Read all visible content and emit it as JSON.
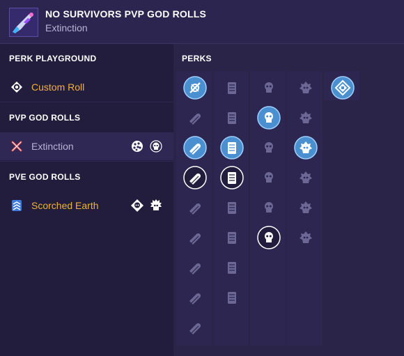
{
  "header": {
    "title": "NO SURVIVORS PVP GOD ROLLS",
    "subtitle": "Extinction",
    "weapon_icon": "weapon-thumbnail"
  },
  "sidebar": {
    "sections": [
      {
        "title": "PERK PLAYGROUND",
        "items": [
          {
            "label": "Custom Roll",
            "icon": "target-icon",
            "color": "#f2b233",
            "selected": false,
            "mini_icons": []
          }
        ]
      },
      {
        "title": "PVP GOD ROLLS",
        "items": [
          {
            "label": "Extinction",
            "icon": "crossed-swords-icon",
            "color": "#b9b4d6",
            "selected": true,
            "mini_icons": [
              "dots-icon",
              "skull-icon"
            ]
          }
        ]
      },
      {
        "title": "PVE GOD ROLLS",
        "items": [
          {
            "label": "Scorched Earth",
            "icon": "chevrons-icon",
            "color": "#f2b233",
            "selected": false,
            "mini_icons": [
              "diamond-skull-icon",
              "flame-skull-icon"
            ]
          }
        ]
      }
    ]
  },
  "perks": {
    "title": "PERKS",
    "columns": [
      [
        "scope-selected",
        "barrel-dim",
        "barrel-selected",
        "barrel-white",
        "barrel-dim",
        "barrel-dim",
        "barrel-dim",
        "barrel-dim",
        "barrel-dim"
      ],
      [
        "magazine-dim",
        "magazine-dim",
        "magazine-selected",
        "magazine-white",
        "magazine-dim",
        "magazine-dim",
        "magazine-dim",
        "magazine-dim"
      ],
      [
        "trait-dim",
        "trait-selected",
        "trait-dim",
        "trait-dim",
        "trait-dim",
        "trait-white"
      ],
      [
        "trait2-dim",
        "trait2-dim",
        "trait2-selected",
        "trait2-dim",
        "trait2-dim",
        "trait2-dim"
      ],
      [
        "mod-selected"
      ]
    ]
  }
}
